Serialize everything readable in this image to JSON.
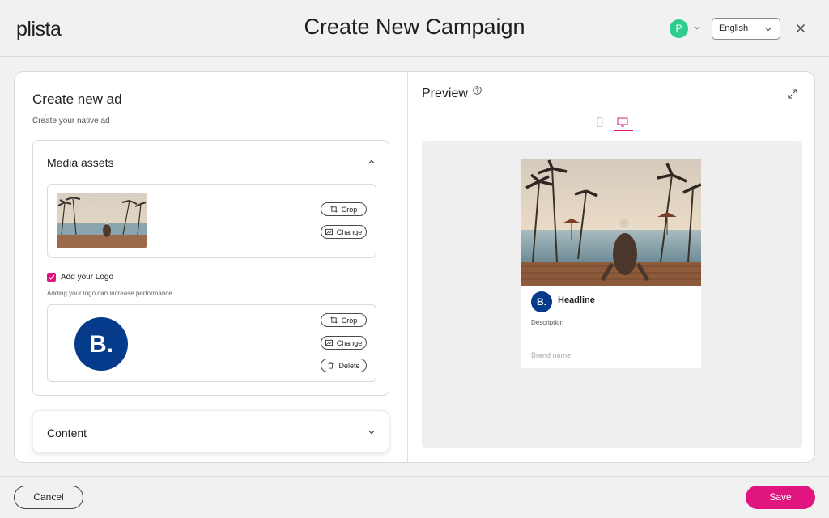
{
  "header": {
    "logo_text": "plista",
    "title": "Create New Campaign",
    "avatar_initial": "P",
    "language": "English"
  },
  "editor": {
    "title": "Create new ad",
    "subtitle": "Create your native ad",
    "media_assets": {
      "heading": "Media assets",
      "image_buttons": {
        "crop": "Crop",
        "change": "Change"
      },
      "logo_checkbox_label": "Add your Logo",
      "logo_checkbox_checked": true,
      "logo_hint": "Adding your logo can increase performance",
      "brand_logo_text": "B.",
      "logo_buttons": {
        "crop": "Crop",
        "change": "Change",
        "delete": "Delete"
      }
    },
    "content": {
      "heading": "Content"
    }
  },
  "preview": {
    "title": "Preview",
    "active_device": "desktop",
    "ad": {
      "logo_text": "B.",
      "headline": "Headline",
      "description": "Description",
      "brand_name": "Brand name"
    }
  },
  "footer": {
    "cancel_label": "Cancel",
    "save_label": "Save"
  },
  "colors": {
    "accent": "#e0157f",
    "avatar": "#2ecc8f",
    "brand_logo": "#063a8a"
  }
}
